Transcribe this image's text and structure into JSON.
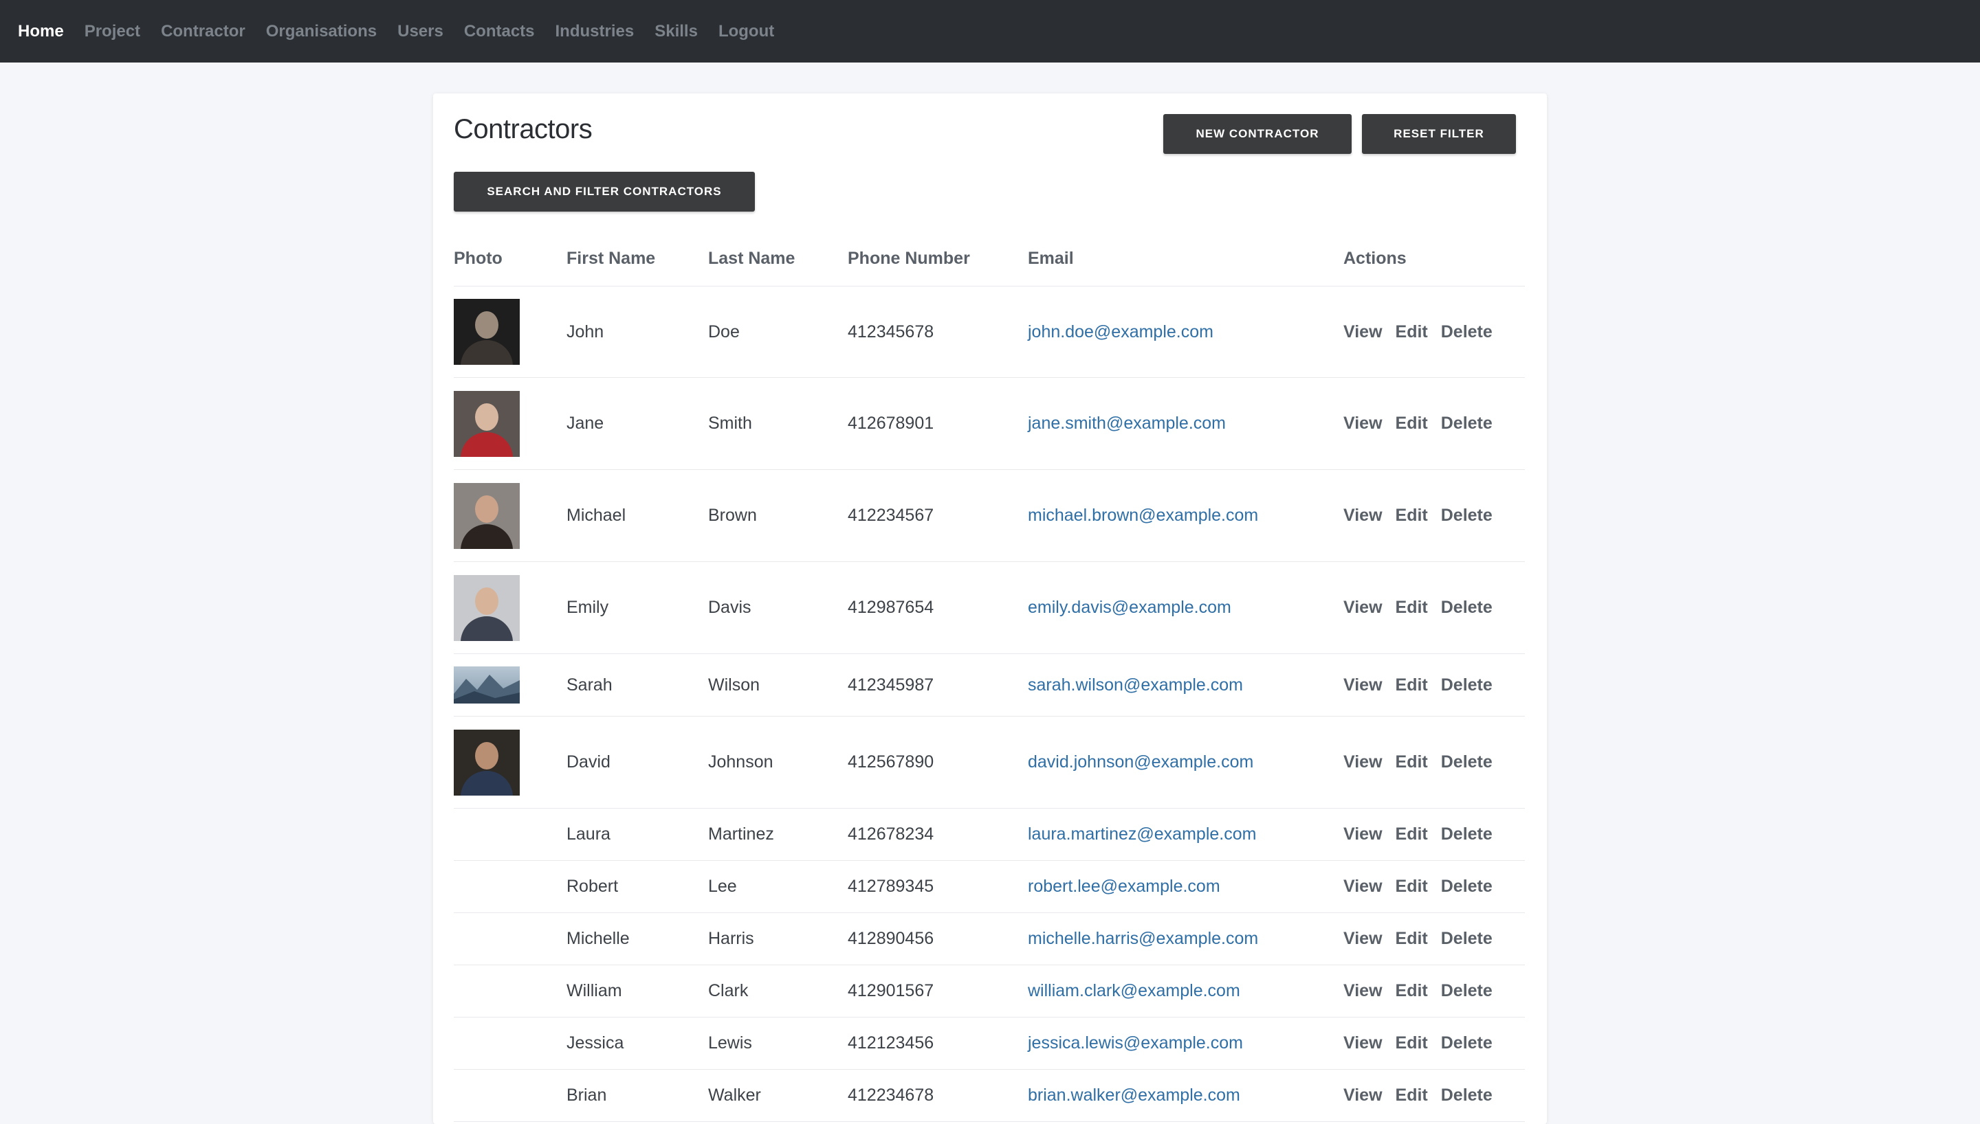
{
  "nav": [
    {
      "label": "Home",
      "active": true
    },
    {
      "label": "Project"
    },
    {
      "label": "Contractor"
    },
    {
      "label": "Organisations"
    },
    {
      "label": "Users"
    },
    {
      "label": "Contacts"
    },
    {
      "label": "Industries"
    },
    {
      "label": "Skills"
    },
    {
      "label": "Logout"
    }
  ],
  "page": {
    "title": "Contractors",
    "new_button": "NEW CONTRACTOR",
    "reset_button": "RESET FILTER",
    "search_button": "SEARCH AND FILTER CONTRACTORS"
  },
  "table": {
    "headers": [
      "Photo",
      "First Name",
      "Last Name",
      "Phone Number",
      "Email",
      "Actions"
    ],
    "actions": [
      "View",
      "Edit",
      "Delete"
    ],
    "rows": [
      {
        "first": "John",
        "last": "Doe",
        "phone": "412345678",
        "email": "john.doe@example.com",
        "photo": "portrait-older-man"
      },
      {
        "first": "Jane",
        "last": "Smith",
        "phone": "412678901",
        "email": "jane.smith@example.com",
        "photo": "portrait-woman-red"
      },
      {
        "first": "Michael",
        "last": "Brown",
        "phone": "412234567",
        "email": "michael.brown@example.com",
        "photo": "portrait-woman-long-hair"
      },
      {
        "first": "Emily",
        "last": "Davis",
        "phone": "412987654",
        "email": "emily.davis@example.com",
        "photo": "portrait-woman-suit"
      },
      {
        "first": "Sarah",
        "last": "Wilson",
        "phone": "412345987",
        "email": "sarah.wilson@example.com",
        "photo": "landscape-mountains"
      },
      {
        "first": "David",
        "last": "Johnson",
        "phone": "412567890",
        "email": "david.johnson@example.com",
        "photo": "portrait-man-suit"
      },
      {
        "first": "Laura",
        "last": "Martinez",
        "phone": "412678234",
        "email": "laura.martinez@example.com",
        "photo": ""
      },
      {
        "first": "Robert",
        "last": "Lee",
        "phone": "412789345",
        "email": "robert.lee@example.com",
        "photo": ""
      },
      {
        "first": "Michelle",
        "last": "Harris",
        "phone": "412890456",
        "email": "michelle.harris@example.com",
        "photo": ""
      },
      {
        "first": "William",
        "last": "Clark",
        "phone": "412901567",
        "email": "william.clark@example.com",
        "photo": ""
      },
      {
        "first": "Jessica",
        "last": "Lewis",
        "phone": "412123456",
        "email": "jessica.lewis@example.com",
        "photo": ""
      },
      {
        "first": "Brian",
        "last": "Walker",
        "phone": "412234678",
        "email": "brian.walker@example.com",
        "photo": ""
      }
    ]
  },
  "colors": {
    "navbar": "#2b2e33",
    "button": "#3b3c3e",
    "link": "#2f6fa6"
  }
}
